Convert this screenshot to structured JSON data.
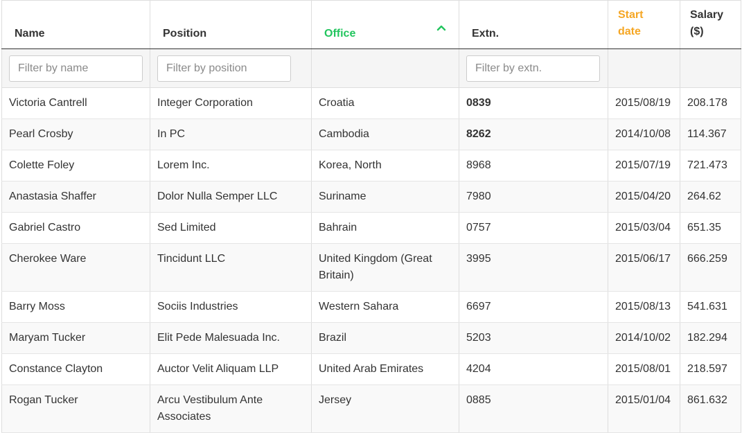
{
  "headers": {
    "name": "Name",
    "position": "Position",
    "office": "Office",
    "extn": "Extn.",
    "start_date_1": "Start",
    "start_date_2": "date",
    "salary_1": "Salary",
    "salary_2": "($)"
  },
  "sort": {
    "column": "office",
    "direction": "ascending",
    "icon": "chevron-up-icon",
    "color": "#22c55e"
  },
  "highlight_color": "#f5a623",
  "filters": {
    "name_placeholder": "Filter by name",
    "position_placeholder": "Filter by position",
    "extn_placeholder": "Filter by extn."
  },
  "rows": [
    {
      "name": "Victoria Cantrell",
      "position": "Integer Corporation",
      "office": "Croatia",
      "extn": "0839",
      "start": "2015/08/19",
      "salary": "208.178"
    },
    {
      "name": "Pearl Crosby",
      "position": "In PC",
      "office": "Cambodia",
      "extn": "8262",
      "start": "2014/10/08",
      "salary": "114.367"
    },
    {
      "name": "Colette Foley",
      "position": "Lorem Inc.",
      "office": "Korea, North",
      "extn": "8968",
      "start": "2015/07/19",
      "salary": "721.473"
    },
    {
      "name": "Anastasia Shaffer",
      "position": "Dolor Nulla Semper LLC",
      "office": "Suriname",
      "extn": "7980",
      "start": "2015/04/20",
      "salary": "264.62"
    },
    {
      "name": "Gabriel Castro",
      "position": "Sed Limited",
      "office": "Bahrain",
      "extn": "0757",
      "start": "2015/03/04",
      "salary": "651.35"
    },
    {
      "name": "Cherokee Ware",
      "position": "Tincidunt LLC",
      "office": "United Kingdom (Great Britain)",
      "extn": "3995",
      "start": "2015/06/17",
      "salary": "666.259"
    },
    {
      "name": "Barry Moss",
      "position": "Sociis Industries",
      "office": "Western Sahara",
      "extn": "6697",
      "start": "2015/08/13",
      "salary": "541.631"
    },
    {
      "name": "Maryam Tucker",
      "position": "Elit Pede Malesuada Inc.",
      "office": "Brazil",
      "extn": "5203",
      "start": "2014/10/02",
      "salary": "182.294"
    },
    {
      "name": "Constance Clayton",
      "position": "Auctor Velit Aliquam LLP",
      "office": "United Arab Emirates",
      "extn": "4204",
      "start": "2015/08/01",
      "salary": "218.597"
    },
    {
      "name": "Rogan Tucker",
      "position": "Arcu Vestibulum Ante Associates",
      "office": "Jersey",
      "extn": "0885",
      "start": "2015/01/04",
      "salary": "861.632"
    }
  ]
}
